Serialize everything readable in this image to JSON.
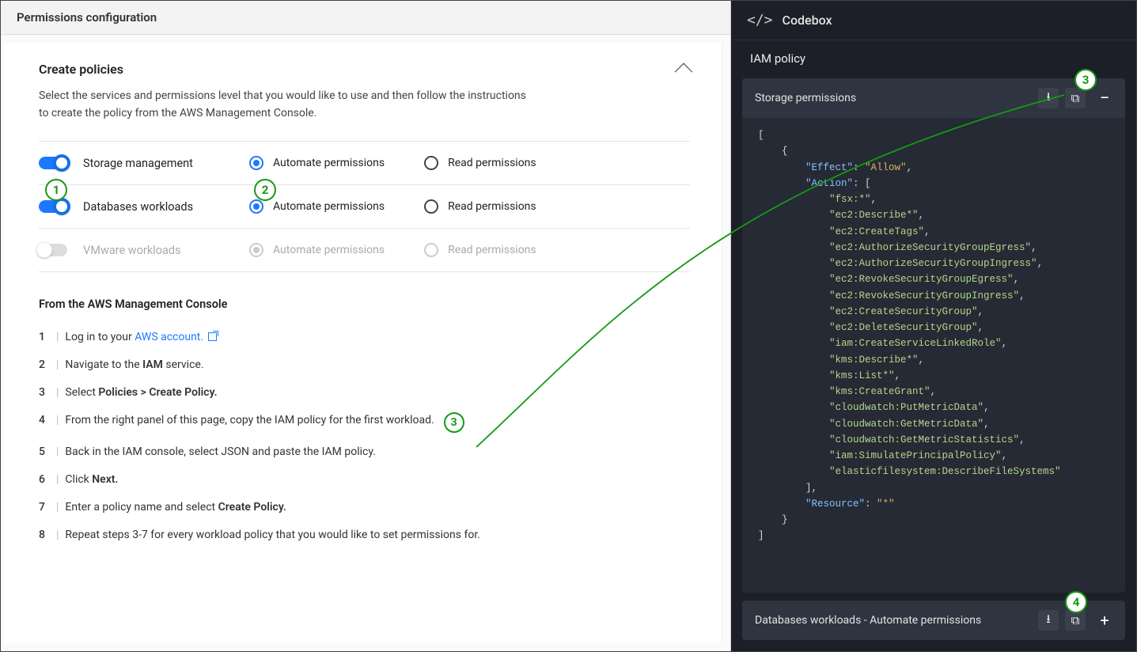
{
  "header": {
    "title": "Permissions configuration"
  },
  "panel": {
    "title": "Create policies",
    "desc1": "Select the services and permissions level that you would like to use and then follow the instructions",
    "desc2": "to create the policy from the AWS Management Console.",
    "rows": [
      {
        "name": "Storage management",
        "enabled": true,
        "opt_auto": "Automate permissions",
        "opt_read": "Read permissions",
        "selected": "auto"
      },
      {
        "name": "Databases workloads",
        "enabled": true,
        "opt_auto": "Automate permissions",
        "opt_read": "Read permissions",
        "selected": "auto"
      },
      {
        "name": "VMware workloads",
        "enabled": false,
        "opt_auto": "Automate permissions",
        "opt_read": "Read permissions",
        "selected": "auto"
      }
    ],
    "badge1": "1",
    "badge2": "2"
  },
  "instructions": {
    "title": "From the AWS Management Console",
    "steps": [
      {
        "n": "1",
        "pre": "Log in to your ",
        "link": "AWS account.",
        "post": ""
      },
      {
        "n": "2",
        "pre": "Navigate to the ",
        "bold": "IAM",
        "post": " service."
      },
      {
        "n": "3",
        "pre": "Select ",
        "bold": "Policies > Create Policy.",
        "post": ""
      },
      {
        "n": "4",
        "pre": "From the right panel of this page, copy the IAM policy for the first workload.",
        "badge": "3"
      },
      {
        "n": "5",
        "pre": "Back in the IAM console, select JSON and paste the IAM policy."
      },
      {
        "n": "6",
        "pre": "Click ",
        "bold": "Next.",
        "post": ""
      },
      {
        "n": "7",
        "pre": "Enter a policy name and select ",
        "bold": "Create Policy.",
        "post": ""
      },
      {
        "n": "8",
        "pre": "Repeat steps 3-7 for every workload policy that you would like to set permissions for."
      }
    ]
  },
  "right": {
    "header": "Codebox",
    "iam_title": "IAM policy",
    "card_title": "Storage permissions",
    "badge3": "3",
    "collapsed_title": "Databases workloads - Automate permissions",
    "badge4": "4",
    "policy": {
      "Effect": "Allow",
      "Action": [
        "fsx:*",
        "ec2:Describe*",
        "ec2:CreateTags",
        "ec2:AuthorizeSecurityGroupEgress",
        "ec2:AuthorizeSecurityGroupIngress",
        "ec2:RevokeSecurityGroupEgress",
        "ec2:RevokeSecurityGroupIngress",
        "ec2:CreateSecurityGroup",
        "ec2:DeleteSecurityGroup",
        "iam:CreateServiceLinkedRole",
        "kms:Describe*",
        "kms:List*",
        "kms:CreateGrant",
        "cloudwatch:PutMetricData",
        "cloudwatch:GetMetricData",
        "cloudwatch:GetMetricStatistics",
        "iam:SimulatePrincipalPolicy",
        "elasticfilesystem:DescribeFileSystems"
      ],
      "Resource": "*"
    }
  }
}
